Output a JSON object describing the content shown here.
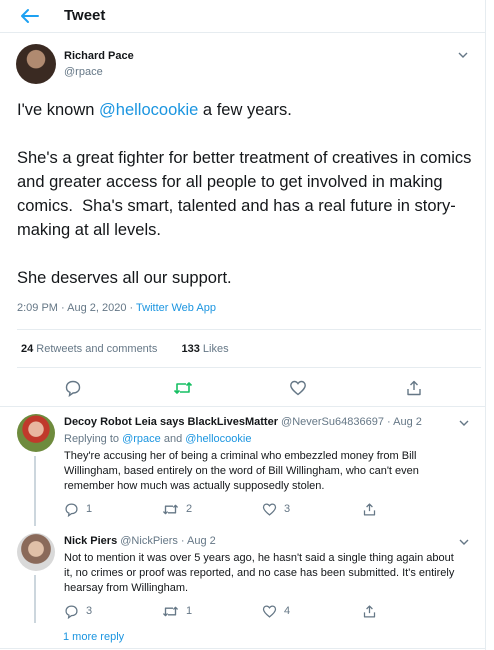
{
  "header": {
    "title": "Tweet"
  },
  "tweet": {
    "author_name": "Richard Pace",
    "author_handle": "@rpace",
    "text_before": "I've known ",
    "mention": "@hellocookie",
    "text_after": " a few years.\n\nShe's a great fighter for better treatment of creatives in comics and greater access for all people to get involved in making comics.  Sha's smart, talented and has a real future in story-making at all levels.\n\nShe deserves all our support.",
    "timestamp": "2:09 PM · Aug 2, 2020 · ",
    "app": "Twitter Web App",
    "retweets_count": "24",
    "retweets_label": " Retweets and comments",
    "likes_count": "133",
    "likes_label": " Likes"
  },
  "replies": [
    {
      "name": "Decoy Robot Leia says BlackLivesMatter",
      "handle_date": " @NeverSu64836697 · Aug 2",
      "replying_prefix": "Replying to ",
      "replying_to_1": "@rpace",
      "replying_and": " and ",
      "replying_to_2": "@hellocookie",
      "text": "They're accusing her of being a criminal who embezzled money from Bill Willingham, based entirely on the word of Bill Willingham, who can't even remember how much was actually supposedly stolen.",
      "reply_count": "1",
      "retweet_count": "2",
      "like_count": "3"
    },
    {
      "name": "Nick Piers",
      "handle_date": " @NickPiers · Aug 2",
      "text": "Not to mention it was over 5 years ago, he hasn't said a single thing again about it, no crimes or proof was reported, and no case has been submitted. It's entirely hearsay from Willingham.",
      "reply_count": "3",
      "retweet_count": "1",
      "like_count": "4"
    }
  ],
  "more_replies": "1 more reply",
  "colors": {
    "accent": "#1da1f2",
    "retweet_green": "#17bf63",
    "secondary_text": "#657786"
  }
}
